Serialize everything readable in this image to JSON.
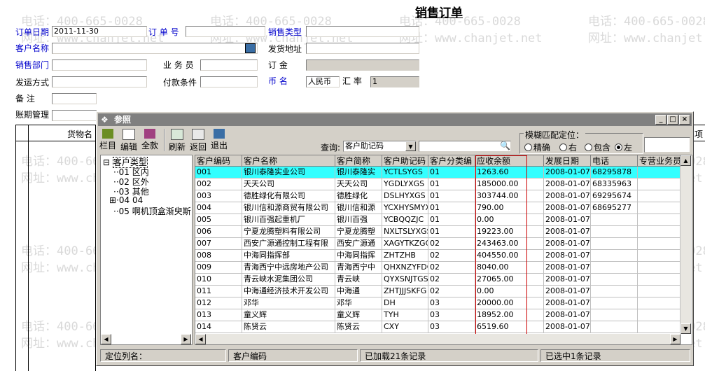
{
  "watermark": {
    "phone": "电话：400-665-0028",
    "site": "网址：www.chanjet.net"
  },
  "form": {
    "title": "销售订单",
    "labels": {
      "order_date": "订单日期",
      "order_no": "订 单 号",
      "sales_type": "销售类型",
      "customer": "客户名称",
      "ship_addr": "发货地址",
      "sales_dept": "销售部门",
      "salesman": "业 务 员",
      "order_amt": "订    金",
      "ship_method": "发运方式",
      "pay_terms": "付款条件",
      "currency": "币    名",
      "rate": "汇  率",
      "note": "备    注",
      "period": "账期管理",
      "goods": "货物名",
      "more": "项"
    },
    "values": {
      "order_date": "2011-11-30",
      "currency": "人民币",
      "rate": "1"
    }
  },
  "dialog": {
    "title": "参照",
    "toolbar": [
      "栏目",
      "编辑",
      "全款",
      "刷新",
      "返回",
      "退出"
    ],
    "query_label": "查询:",
    "query_field": "客户助记码",
    "query_value": "",
    "fuzzy_label": "模糊匹配定位：",
    "fuzzy_options": [
      "精确",
      "右",
      "包含",
      "左"
    ],
    "fuzzy_selected": "左",
    "tree": {
      "root": "客户类型",
      "items": [
        "01 区内",
        "02 区外",
        "03 其他",
        "04 04",
        "05 啊机顶盒渐臾斯"
      ]
    },
    "columns": [
      "客户编码",
      "客户名称",
      "客户简称",
      "客户助记码",
      "客户分类编",
      "应收余额",
      "发展日期",
      "电话",
      "专营业务员"
    ],
    "rows": [
      [
        "001",
        "银川泰隆实业公司",
        "银川泰隆实",
        "YCTLSYGS",
        "01",
        "1263.60",
        "2008-01-07",
        "68295878",
        ""
      ],
      [
        "002",
        "天天公司",
        "天天公司",
        "YGDLYXGS",
        "01",
        "185000.00",
        "2008-01-07",
        "68335963",
        ""
      ],
      [
        "003",
        "德胜绿化有限公司",
        "德胜绿化",
        "DSLHYXGS",
        "01",
        "303744.00",
        "2008-01-07",
        "69295674",
        ""
      ],
      [
        "004",
        "银川信和源商贸有限公司",
        "银川信和源",
        "YCXHYSMYXG",
        "01",
        "790.00",
        "2008-01-07",
        "68695277",
        ""
      ],
      [
        "005",
        "银川百强起重机厂",
        "银川百强",
        "YCBQQZJC",
        "01",
        "0.00",
        "2008-01-07",
        "",
        ""
      ],
      [
        "006",
        "宁夏龙腾塑料有限公司",
        "宁夏龙腾塑",
        "NXLTSLYXGS",
        "01",
        "19223.00",
        "2008-01-07",
        "",
        ""
      ],
      [
        "007",
        "西安广源通控制工程有限",
        "西安广源通",
        "XAGYTKZGCY",
        "02",
        "243463.00",
        "2008-01-07",
        "",
        ""
      ],
      [
        "008",
        "中海同指挥部",
        "中海同指挥",
        "ZHTZHB",
        "02",
        "404550.00",
        "2008-01-07",
        "",
        ""
      ],
      [
        "009",
        "青海西宁中远房地产公司",
        "青海西宁中",
        "QHXNZYFDCG",
        "02",
        "8040.00",
        "2008-01-07",
        "",
        ""
      ],
      [
        "010",
        "青云峡水泥集团公司",
        "青云峡",
        "QYXSNJTGS",
        "02",
        "27065.00",
        "2008-01-07",
        "",
        ""
      ],
      [
        "011",
        "中海通经济技术开发公司",
        "中海通",
        "ZHTJJJSKFG",
        "02",
        "0.00",
        "2008-01-07",
        "",
        ""
      ],
      [
        "012",
        "邓华",
        "邓华",
        "DH",
        "03",
        "20000.00",
        "2008-01-07",
        "",
        ""
      ],
      [
        "013",
        "童义辉",
        "童义辉",
        "TYH",
        "03",
        "18952.00",
        "2008-01-07",
        "",
        ""
      ],
      [
        "014",
        "陈贤云",
        "陈贤云",
        "CXY",
        "03",
        "6519.60",
        "2008-01-07",
        "",
        ""
      ]
    ],
    "status": {
      "locate": "定位列名：",
      "locate_value": "客户编码",
      "loaded": "已加载21条记录",
      "selected": "已选中1条记录"
    },
    "highlight_color": "#33ffff",
    "highlight_box_color": "#cc0000"
  }
}
